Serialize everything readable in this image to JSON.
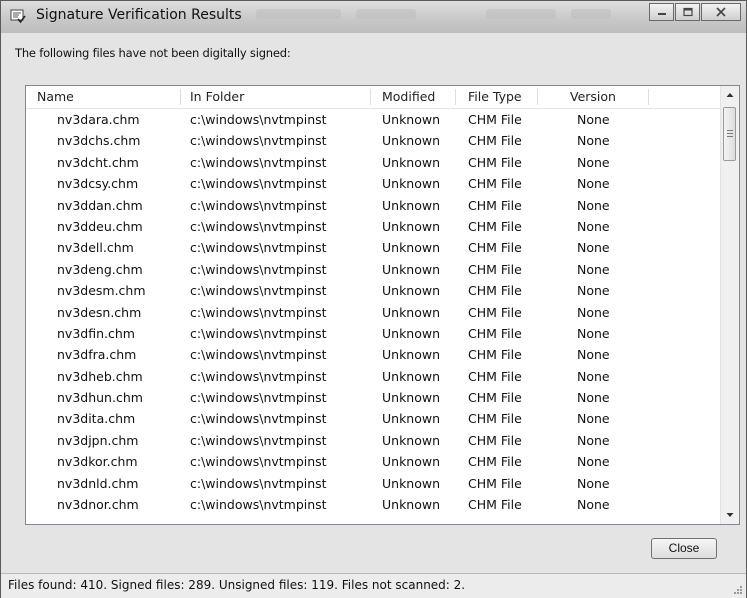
{
  "window": {
    "title": "Signature Verification Results"
  },
  "intro": "The following files have not been digitally signed:",
  "table": {
    "columns": [
      "Name",
      "In Folder",
      "Modified",
      "File Type",
      "Version"
    ],
    "rows": [
      [
        "nv3dara.chm",
        "c:\\windows\\nvtmpinst",
        "Unknown",
        "CHM File",
        "None"
      ],
      [
        "nv3dchs.chm",
        "c:\\windows\\nvtmpinst",
        "Unknown",
        "CHM File",
        "None"
      ],
      [
        "nv3dcht.chm",
        "c:\\windows\\nvtmpinst",
        "Unknown",
        "CHM File",
        "None"
      ],
      [
        "nv3dcsy.chm",
        "c:\\windows\\nvtmpinst",
        "Unknown",
        "CHM File",
        "None"
      ],
      [
        "nv3ddan.chm",
        "c:\\windows\\nvtmpinst",
        "Unknown",
        "CHM File",
        "None"
      ],
      [
        "nv3ddeu.chm",
        "c:\\windows\\nvtmpinst",
        "Unknown",
        "CHM File",
        "None"
      ],
      [
        "nv3dell.chm",
        "c:\\windows\\nvtmpinst",
        "Unknown",
        "CHM File",
        "None"
      ],
      [
        "nv3deng.chm",
        "c:\\windows\\nvtmpinst",
        "Unknown",
        "CHM File",
        "None"
      ],
      [
        "nv3desm.chm",
        "c:\\windows\\nvtmpinst",
        "Unknown",
        "CHM File",
        "None"
      ],
      [
        "nv3desn.chm",
        "c:\\windows\\nvtmpinst",
        "Unknown",
        "CHM File",
        "None"
      ],
      [
        "nv3dfin.chm",
        "c:\\windows\\nvtmpinst",
        "Unknown",
        "CHM File",
        "None"
      ],
      [
        "nv3dfra.chm",
        "c:\\windows\\nvtmpinst",
        "Unknown",
        "CHM File",
        "None"
      ],
      [
        "nv3dheb.chm",
        "c:\\windows\\nvtmpinst",
        "Unknown",
        "CHM File",
        "None"
      ],
      [
        "nv3dhun.chm",
        "c:\\windows\\nvtmpinst",
        "Unknown",
        "CHM File",
        "None"
      ],
      [
        "nv3dita.chm",
        "c:\\windows\\nvtmpinst",
        "Unknown",
        "CHM File",
        "None"
      ],
      [
        "nv3djpn.chm",
        "c:\\windows\\nvtmpinst",
        "Unknown",
        "CHM File",
        "None"
      ],
      [
        "nv3dkor.chm",
        "c:\\windows\\nvtmpinst",
        "Unknown",
        "CHM File",
        "None"
      ],
      [
        "nv3dnld.chm",
        "c:\\windows\\nvtmpinst",
        "Unknown",
        "CHM File",
        "None"
      ],
      [
        "nv3dnor.chm",
        "c:\\windows\\nvtmpinst",
        "Unknown",
        "CHM File",
        "None"
      ]
    ]
  },
  "buttons": {
    "close": "Close"
  },
  "status": "Files found: 410.  Signed files: 289.  Unsigned files: 119.  Files not scanned: 2.",
  "icons": {
    "title": "certificate-check-icon",
    "minimize": "minimize-icon",
    "maximize": "maximize-icon",
    "close": "close-icon",
    "scroll_up": "scroll-up-arrow-icon",
    "scroll_down": "scroll-down-arrow-icon",
    "resize": "resize-grip-icon"
  },
  "colors": {
    "window_bg": "#e4e4e4",
    "list_bg": "#ffffff",
    "border": "#828790"
  }
}
